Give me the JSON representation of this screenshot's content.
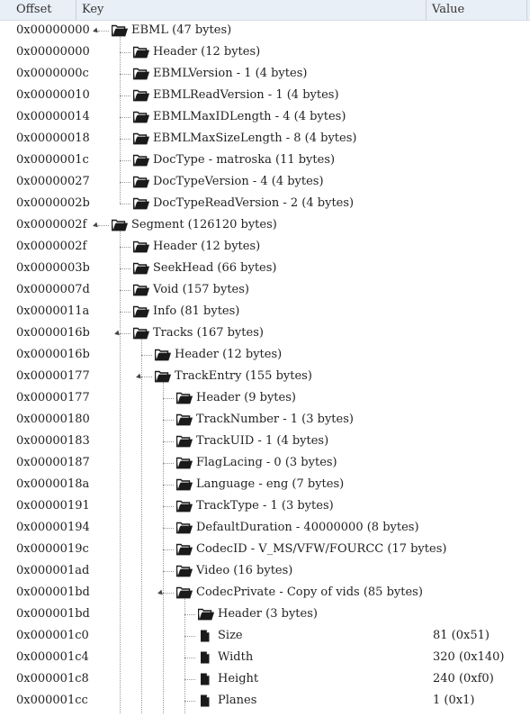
{
  "columns": {
    "offset": "Offset",
    "key": "Key",
    "value": "Value"
  },
  "icons": {
    "folder": "folder-icon",
    "file": "file-icon"
  },
  "rows": [
    {
      "offset": "0x00000000",
      "key": "EBML (47 bytes)",
      "value": "",
      "depth": 0,
      "type": "folder",
      "expanded": true
    },
    {
      "offset": "0x00000000",
      "key": "Header (12 bytes)",
      "value": "",
      "depth": 1,
      "type": "folder",
      "expanded": false
    },
    {
      "offset": "0x0000000c",
      "key": "EBMLVersion - 1 (4 bytes)",
      "value": "",
      "depth": 1,
      "type": "folder",
      "expanded": false
    },
    {
      "offset": "0x00000010",
      "key": "EBMLReadVersion - 1 (4 bytes)",
      "value": "",
      "depth": 1,
      "type": "folder",
      "expanded": false
    },
    {
      "offset": "0x00000014",
      "key": "EBMLMaxIDLength - 4 (4 bytes)",
      "value": "",
      "depth": 1,
      "type": "folder",
      "expanded": false
    },
    {
      "offset": "0x00000018",
      "key": "EBMLMaxSizeLength - 8 (4 bytes)",
      "value": "",
      "depth": 1,
      "type": "folder",
      "expanded": false
    },
    {
      "offset": "0x0000001c",
      "key": "DocType - matroska (11 bytes)",
      "value": "",
      "depth": 1,
      "type": "folder",
      "expanded": false
    },
    {
      "offset": "0x00000027",
      "key": "DocTypeVersion - 4 (4 bytes)",
      "value": "",
      "depth": 1,
      "type": "folder",
      "expanded": false
    },
    {
      "offset": "0x0000002b",
      "key": "DocTypeReadVersion - 2 (4 bytes)",
      "value": "",
      "depth": 1,
      "type": "folder",
      "expanded": false
    },
    {
      "offset": "0x0000002f",
      "key": "Segment (126120 bytes)",
      "value": "",
      "depth": 0,
      "type": "folder",
      "expanded": true
    },
    {
      "offset": "0x0000002f",
      "key": "Header (12 bytes)",
      "value": "",
      "depth": 1,
      "type": "folder",
      "expanded": false
    },
    {
      "offset": "0x0000003b",
      "key": "SeekHead (66 bytes)",
      "value": "",
      "depth": 1,
      "type": "folder",
      "expanded": false
    },
    {
      "offset": "0x0000007d",
      "key": "Void (157 bytes)",
      "value": "",
      "depth": 1,
      "type": "folder",
      "expanded": false
    },
    {
      "offset": "0x0000011a",
      "key": "Info (81 bytes)",
      "value": "",
      "depth": 1,
      "type": "folder",
      "expanded": false
    },
    {
      "offset": "0x0000016b",
      "key": "Tracks (167 bytes)",
      "value": "",
      "depth": 1,
      "type": "folder",
      "expanded": true
    },
    {
      "offset": "0x0000016b",
      "key": "Header (12 bytes)",
      "value": "",
      "depth": 2,
      "type": "folder",
      "expanded": false
    },
    {
      "offset": "0x00000177",
      "key": "TrackEntry (155 bytes)",
      "value": "",
      "depth": 2,
      "type": "folder",
      "expanded": true
    },
    {
      "offset": "0x00000177",
      "key": "Header (9 bytes)",
      "value": "",
      "depth": 3,
      "type": "folder",
      "expanded": false
    },
    {
      "offset": "0x00000180",
      "key": "TrackNumber - 1 (3 bytes)",
      "value": "",
      "depth": 3,
      "type": "folder",
      "expanded": false
    },
    {
      "offset": "0x00000183",
      "key": "TrackUID - 1 (4 bytes)",
      "value": "",
      "depth": 3,
      "type": "folder",
      "expanded": false
    },
    {
      "offset": "0x00000187",
      "key": "FlagLacing - 0 (3 bytes)",
      "value": "",
      "depth": 3,
      "type": "folder",
      "expanded": false
    },
    {
      "offset": "0x0000018a",
      "key": "Language - eng (7 bytes)",
      "value": "",
      "depth": 3,
      "type": "folder",
      "expanded": false
    },
    {
      "offset": "0x00000191",
      "key": "TrackType - 1 (3 bytes)",
      "value": "",
      "depth": 3,
      "type": "folder",
      "expanded": false
    },
    {
      "offset": "0x00000194",
      "key": "DefaultDuration - 40000000 (8 bytes)",
      "value": "",
      "depth": 3,
      "type": "folder",
      "expanded": false
    },
    {
      "offset": "0x0000019c",
      "key": "CodecID - V_MS/VFW/FOURCC (17 bytes)",
      "value": "",
      "depth": 3,
      "type": "folder",
      "expanded": false
    },
    {
      "offset": "0x000001ad",
      "key": "Video (16 bytes)",
      "value": "",
      "depth": 3,
      "type": "folder",
      "expanded": false
    },
    {
      "offset": "0x000001bd",
      "key": "CodecPrivate - Copy of vids (85 bytes)",
      "value": "",
      "depth": 3,
      "type": "folder",
      "expanded": true
    },
    {
      "offset": "0x000001bd",
      "key": "Header (3 bytes)",
      "value": "",
      "depth": 4,
      "type": "folder",
      "expanded": false
    },
    {
      "offset": "0x000001c0",
      "key": "Size",
      "value": "81 (0x51)",
      "depth": 4,
      "type": "file",
      "expanded": false
    },
    {
      "offset": "0x000001c4",
      "key": "Width",
      "value": "320 (0x140)",
      "depth": 4,
      "type": "file",
      "expanded": false
    },
    {
      "offset": "0x000001c8",
      "key": "Height",
      "value": "240 (0xf0)",
      "depth": 4,
      "type": "file",
      "expanded": false
    },
    {
      "offset": "0x000001cc",
      "key": "Planes",
      "value": "1 (0x1)",
      "depth": 4,
      "type": "file",
      "expanded": false
    }
  ]
}
